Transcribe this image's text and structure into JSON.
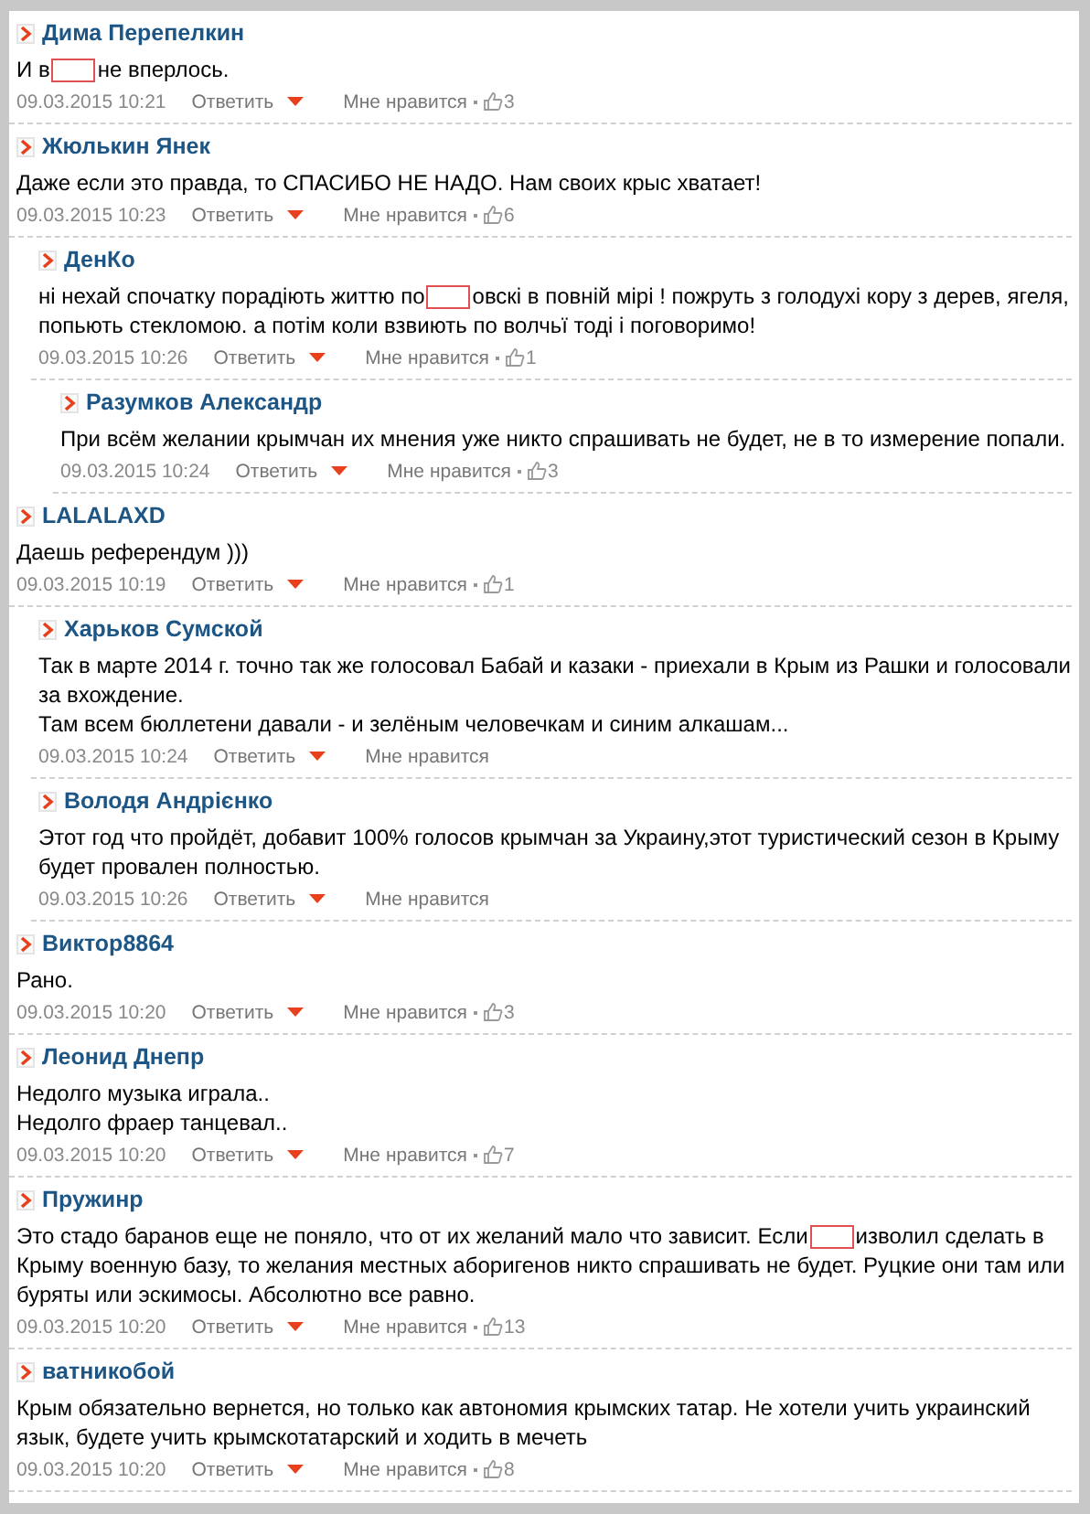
{
  "comments": [
    {
      "author": "Дима Перепелкин",
      "lines": [
        [
          {
            "kind": "text",
            "text": "И в"
          },
          {
            "kind": "redaction"
          },
          {
            "kind": "text",
            "text": "не вперлось."
          }
        ]
      ],
      "date": "09.03.2015 10:21",
      "reply": "Ответить",
      "like": "Мне нравится",
      "likes": "3"
    },
    {
      "author": "Жюлькин Янек",
      "lines": [
        [
          {
            "kind": "text",
            "text": "Даже если это правда, то СПАСИБО НЕ НАДО. Нам своих крыс хватает!"
          }
        ]
      ],
      "date": "09.03.2015 10:23",
      "reply": "Ответить",
      "like": "Мне нравится",
      "likes": "6",
      "children": [
        {
          "author": "ДенКо",
          "lines": [
            [
              {
                "kind": "text",
                "text": "ні нехай спочатку порадіють життю по"
              },
              {
                "kind": "redaction"
              },
              {
                "kind": "text",
                "text": "овскі в повній мірі ! пожруть з голодухі кору з дерев, ягеля, попьють стекломою. а потім коли взвиють по волчьї тоді і поговоримо!"
              }
            ]
          ],
          "date": "09.03.2015 10:26",
          "reply": "Ответить",
          "like": "Мне нравится",
          "likes": "1",
          "children": [
            {
              "author": "Разумков Александр",
              "lines": [
                [
                  {
                    "kind": "text",
                    "text": "При всём желании крымчан их мнения уже никто спрашивать не будет, не в то измерение попали."
                  }
                ]
              ],
              "date": "09.03.2015 10:24",
              "reply": "Ответить",
              "like": "Мне нравится",
              "likes": "3"
            }
          ]
        }
      ]
    },
    {
      "author": "LALALAXD",
      "lines": [
        [
          {
            "kind": "text",
            "text": "Даешь референдум )))"
          }
        ]
      ],
      "date": "09.03.2015 10:19",
      "reply": "Ответить",
      "like": "Мне нравится",
      "likes": "1",
      "children": [
        {
          "author": "Харьков Сумской",
          "lines": [
            [
              {
                "kind": "text",
                "text": "Так в марте 2014 г. точно так же голосовал Бабай и казаки - приехали в Крым из Рашки и голосовали за вхождение."
              }
            ],
            [
              {
                "kind": "text",
                "text": "Там всем бюллетени давали - и зелёным человечкам и синим алкашам..."
              }
            ]
          ],
          "date": "09.03.2015 10:24",
          "reply": "Ответить",
          "like": "Мне нравится"
        },
        {
          "author": "Володя Андрієнко",
          "lines": [
            [
              {
                "kind": "text",
                "text": "Этот год что пройдёт, добавит 100% голосов крымчан за Украину,этот туристический сезон в Крыму будет провален полностью."
              }
            ]
          ],
          "date": "09.03.2015 10:26",
          "reply": "Ответить",
          "like": "Мне нравится"
        }
      ]
    },
    {
      "author": "Виктор8864",
      "lines": [
        [
          {
            "kind": "text",
            "text": "Рано."
          }
        ]
      ],
      "date": "09.03.2015 10:20",
      "reply": "Ответить",
      "like": "Мне нравится",
      "likes": "3"
    },
    {
      "author": "Леонид Днепр",
      "lines": [
        [
          {
            "kind": "text",
            "text": "Недолго музыка играла.."
          }
        ],
        [
          {
            "kind": "text",
            "text": "Недолго фраер танцевал.."
          }
        ]
      ],
      "date": "09.03.2015 10:20",
      "reply": "Ответить",
      "like": "Мне нравится",
      "likes": "7"
    },
    {
      "author": "Пружинр",
      "lines": [
        [
          {
            "kind": "text",
            "text": "Это стадо баранов еще не поняло, что от их желаний мало что зависит. Если"
          },
          {
            "kind": "redaction"
          },
          {
            "kind": "text",
            "text": "изволил сделать в Крыму военную базу, то желания местных аборигенов никто спрашивать не будет. Руцкие они там или буряты или эскимосы. Абсолютно все равно."
          }
        ]
      ],
      "date": "09.03.2015 10:20",
      "reply": "Ответить",
      "like": "Мне нравится",
      "likes": "13"
    },
    {
      "author": "ватникобой",
      "lines": [
        [
          {
            "kind": "text",
            "text": "Крым обязательно вернется, но только как автономия крымских татар. Не хотели учить украинский язык, будете учить крымскотатарский и ходить в мечеть"
          }
        ]
      ],
      "date": "09.03.2015 10:20",
      "reply": "Ответить",
      "like": "Мне нравится",
      "likes": "8"
    }
  ]
}
